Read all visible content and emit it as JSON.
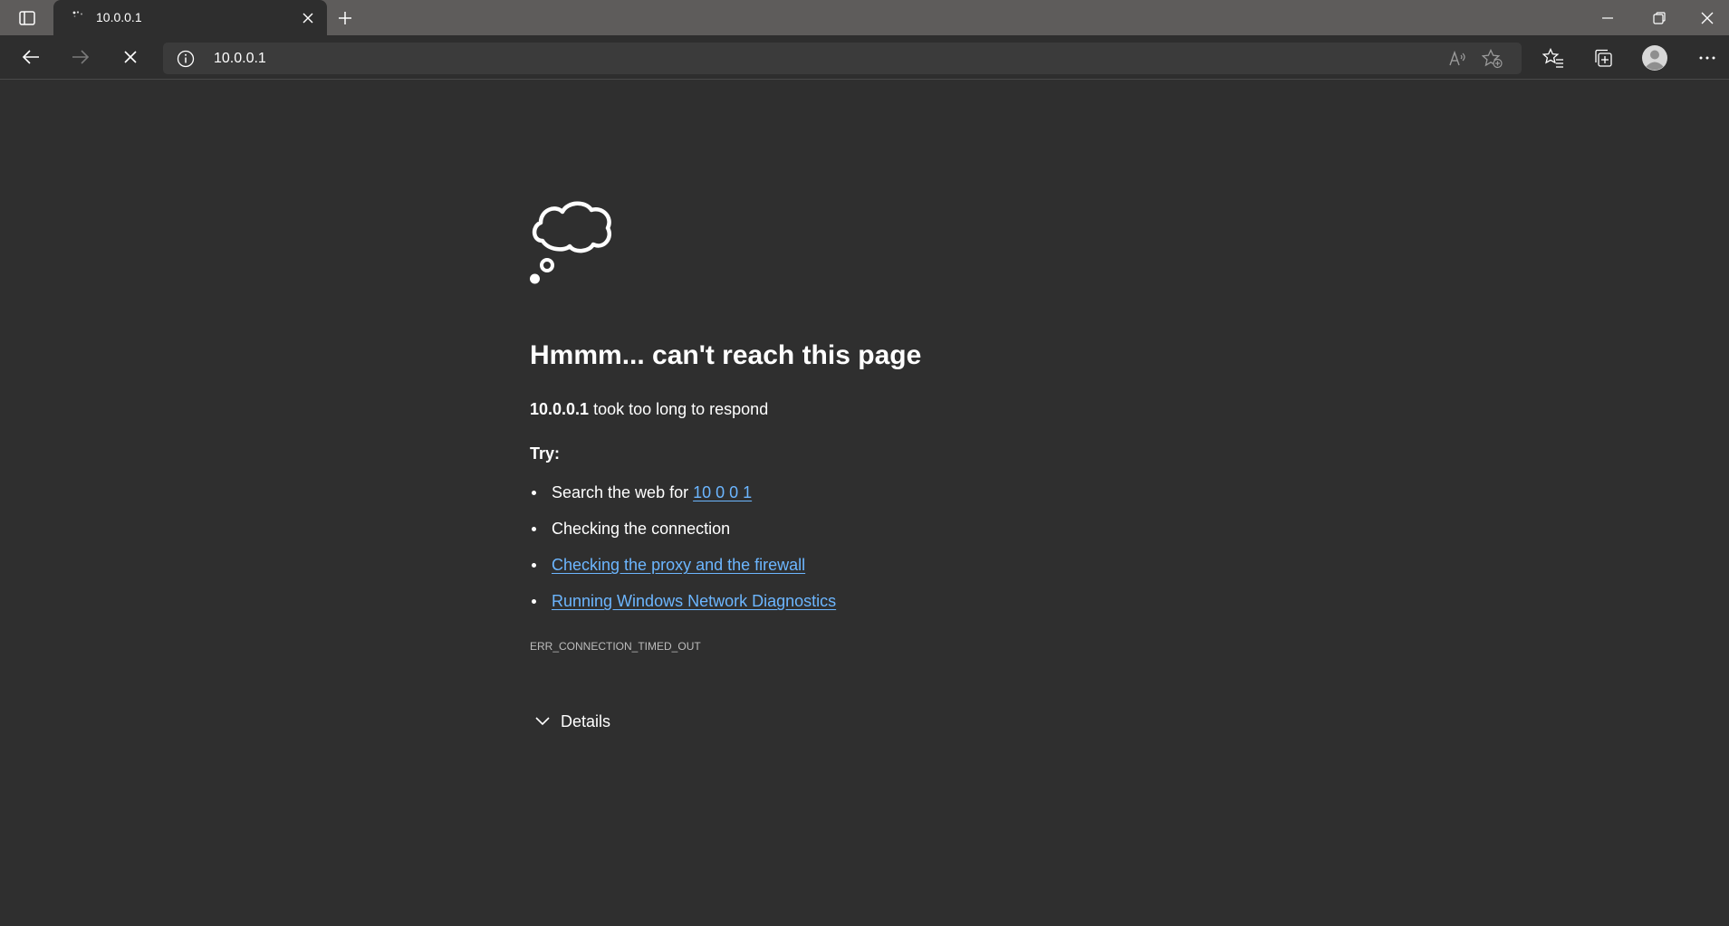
{
  "colors": {
    "titlebar_bg": "#5e5c5b",
    "page_bg": "#2f2f2f",
    "address_bg": "#3b3b3b",
    "link": "#6cb6ff",
    "text": "#ffffff",
    "muted_text": "#bdbdbd"
  },
  "titlebar": {
    "tab_actions_icon": "tab-actions-icon",
    "tab": {
      "title": "10.0.0.1",
      "favicon": "loading-spinner-icon",
      "close_icon": "close-icon"
    },
    "new_tab_icon": "plus-icon",
    "window_controls": [
      "minimize-icon",
      "restore-icon",
      "close-icon"
    ]
  },
  "toolbar": {
    "back_icon": "back-arrow-icon",
    "forward_icon": "forward-arrow-icon",
    "stop_icon": "stop-icon",
    "address": {
      "site_info_icon": "info-icon",
      "url": "10.0.0.1",
      "read_aloud_icon": "read-aloud-icon",
      "add_favorite_icon": "add-favorite-icon"
    },
    "favorites_icon": "favorites-icon",
    "collections_icon": "collections-icon",
    "profile_icon": "profile-avatar-icon",
    "more_icon": "more-icon"
  },
  "error_page": {
    "illustration": "thought-cloud-icon",
    "heading": "Hmmm... can't reach this page",
    "host": "10.0.0.1",
    "message": " took too long to respond",
    "try_label": "Try:",
    "suggestions": [
      {
        "prefix": "Search the web for ",
        "link": "10 0 0 1"
      },
      {
        "text": "Checking the connection"
      },
      {
        "link": "Checking the proxy and the firewall"
      },
      {
        "link": "Running Windows Network Diagnostics"
      }
    ],
    "error_code": "ERR_CONNECTION_TIMED_OUT",
    "details_label": "Details",
    "details_icon": "chevron-down-icon"
  }
}
